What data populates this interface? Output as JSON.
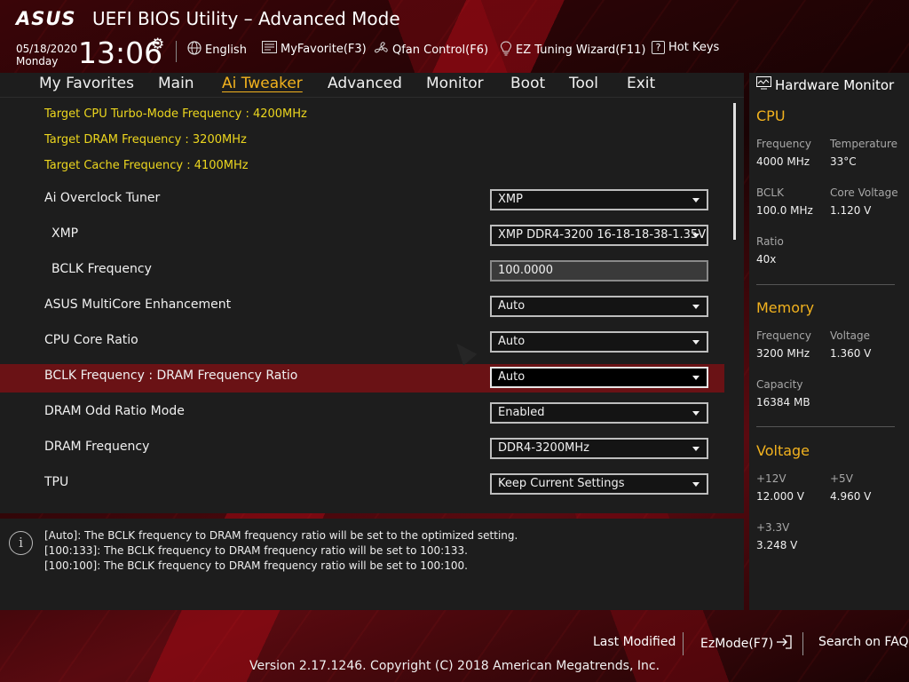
{
  "header": {
    "logo": "ASUS",
    "title": "UEFI BIOS Utility – Advanced Mode",
    "date": "05/18/2020",
    "weekday": "Monday",
    "time": "13:06",
    "items": {
      "language": "English",
      "myfavorite": "MyFavorite(F3)",
      "qfan": "Qfan Control(F6)",
      "ez_tuning": "EZ Tuning Wizard(F11)",
      "hotkeys": "Hot Keys"
    }
  },
  "nav": {
    "tabs": [
      "My Favorites",
      "Main",
      "Ai Tweaker",
      "Advanced",
      "Monitor",
      "Boot",
      "Tool",
      "Exit"
    ],
    "active": "Ai Tweaker"
  },
  "info": [
    "Target CPU Turbo-Mode Frequency : 4200MHz",
    "Target DRAM Frequency : 3200MHz",
    "Target Cache Frequency : 4100MHz"
  ],
  "settings": [
    {
      "label": "Ai Overclock Tuner",
      "value": "XMP",
      "type": "dropdown"
    },
    {
      "label": "XMP",
      "value": "XMP DDR4-3200 16-18-18-38-1.35V",
      "type": "dropdown",
      "sub": true
    },
    {
      "label": "BCLK Frequency",
      "value": "100.0000",
      "type": "field",
      "sub": true
    },
    {
      "label": "ASUS MultiCore Enhancement",
      "value": "Auto",
      "type": "dropdown"
    },
    {
      "label": "CPU Core Ratio",
      "value": "Auto",
      "type": "dropdown"
    },
    {
      "label": "BCLK Frequency : DRAM Frequency Ratio",
      "value": "Auto",
      "type": "dropdown",
      "selected": true
    },
    {
      "label": "DRAM Odd Ratio Mode",
      "value": "Enabled",
      "type": "dropdown"
    },
    {
      "label": "DRAM Frequency",
      "value": "DDR4-3200MHz",
      "type": "dropdown"
    },
    {
      "label": "TPU",
      "value": "Keep Current Settings",
      "type": "dropdown"
    }
  ],
  "help": [
    "[Auto]: The BCLK frequency to DRAM frequency ratio will be set to the optimized setting.",
    "[100:133]: The BCLK frequency to DRAM frequency ratio will be set to 100:133.",
    "[100:100]: The BCLK frequency to DRAM frequency ratio will be set to 100:100."
  ],
  "hw_monitor": {
    "title": "Hardware Monitor",
    "cpu": {
      "heading": "CPU",
      "frequency_label": "Frequency",
      "frequency": "4000 MHz",
      "temperature_label": "Temperature",
      "temperature": "33°C",
      "bclk_label": "BCLK",
      "bclk": "100.0 MHz",
      "core_voltage_label": "Core Voltage",
      "core_voltage": "1.120 V",
      "ratio_label": "Ratio",
      "ratio": "40x"
    },
    "memory": {
      "heading": "Memory",
      "frequency_label": "Frequency",
      "frequency": "3200 MHz",
      "voltage_label": "Voltage",
      "voltage": "1.360 V",
      "capacity_label": "Capacity",
      "capacity": "16384 MB"
    },
    "voltage": {
      "heading": "Voltage",
      "v12_label": "+12V",
      "v12": "12.000 V",
      "v5_label": "+5V",
      "v5": "4.960 V",
      "v33_label": "+3.3V",
      "v33": "3.248 V"
    }
  },
  "footer": {
    "last_modified": "Last Modified",
    "ezmode": "EzMode(F7)",
    "search_faq": "Search on FAQ",
    "copyright": "Version 2.17.1246. Copyright (C) 2018 American Megatrends, Inc."
  }
}
